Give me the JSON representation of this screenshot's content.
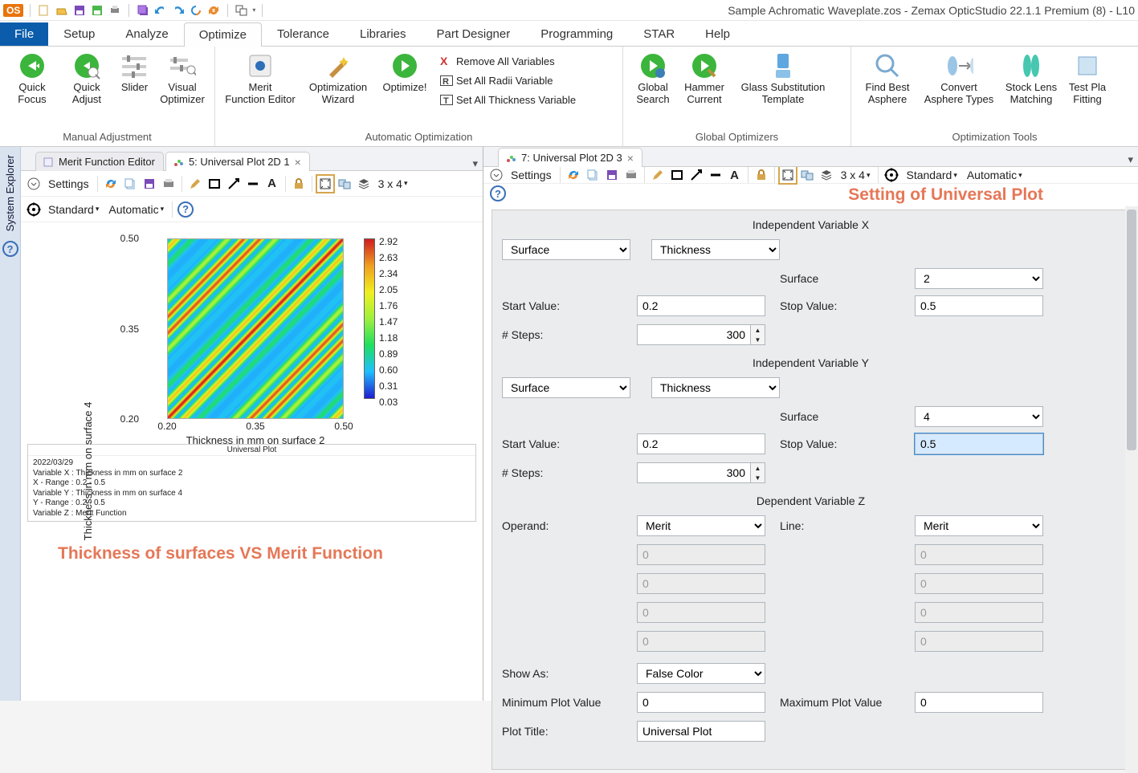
{
  "app_title": "Sample Achromatic Waveplate.zos - Zemax OpticStudio 22.1.1   Premium (8) - L10",
  "topbar": {
    "os": "OS"
  },
  "menu": {
    "file": "File",
    "tabs": [
      "Setup",
      "Analyze",
      "Optimize",
      "Tolerance",
      "Libraries",
      "Part Designer",
      "Programming",
      "STAR",
      "Help"
    ],
    "active": 2
  },
  "ribbon": {
    "manual_label": "Manual Adjustment",
    "auto_label": "Automatic Optimization",
    "global_label": "Global Optimizers",
    "tools_label": "Optimization Tools",
    "quick_focus": "Quick\nFocus",
    "quick_adjust": "Quick\nAdjust",
    "slider": "Slider",
    "visual_optimizer": "Visual\nOptimizer",
    "merit_editor": "Merit\nFunction Editor",
    "opt_wizard": "Optimization\nWizard",
    "optimize": "Optimize!",
    "remove_vars": "Remove All Variables",
    "set_radii": "Set All Radii Variable",
    "set_thick": "Set All Thickness Variable",
    "global_search": "Global\nSearch",
    "hammer": "Hammer\nCurrent",
    "glass_sub": "Glass Substitution\nTemplate",
    "best_asphere": "Find Best\nAsphere",
    "convert_asphere": "Convert\nAsphere Types",
    "stock_lens": "Stock Lens\nMatching",
    "test_plate": "Test Pla\nFitting"
  },
  "left_pane": {
    "tabs": [
      {
        "label": "Merit Function Editor",
        "closable": false
      },
      {
        "label": "5: Universal Plot 2D 1",
        "closable": true
      }
    ],
    "toolbar": {
      "settings": "Settings",
      "grid": "3 x 4",
      "standard": "Standard",
      "automatic": "Automatic"
    },
    "chart": {
      "title": "Universal Plot",
      "y_label": "Thickness in mm on surface 4",
      "x_label": "Thickness in mm on surface 2",
      "y_ticks": [
        "0.50",
        "0.35",
        "0.20"
      ],
      "x_ticks": [
        "0.20",
        "0.35",
        "0.50"
      ],
      "colorbar": [
        "2.92",
        "2.63",
        "2.34",
        "2.05",
        "1.76",
        "1.47",
        "1.18",
        "0.89",
        "0.60",
        "0.31",
        "0.03"
      ],
      "footer_date": "2022/03/29",
      "footer_l1": "Variable X : Thickness in mm on surface 2",
      "footer_l2": "X - Range   : 0.2 - 0.5",
      "footer_l3": "Variable Y : Thickness in mm on surface 4",
      "footer_l4": "Y - Range   : 0.2 - 0.5",
      "footer_l5": "Variable Z : Merit Function"
    },
    "annotation": "Thickness of surfaces VS Merit Function"
  },
  "right_pane": {
    "tab": {
      "label": "7: Universal Plot 2D 3",
      "closable": true
    },
    "toolbar": {
      "settings": "Settings",
      "grid": "3 x 4",
      "standard": "Standard",
      "automatic": "Automatic"
    },
    "annotation": "Setting of Universal Plot",
    "sections": {
      "ivx": "Independent Variable X",
      "ivy": "Independent Variable Y",
      "dvz": "Dependent Variable Z"
    },
    "labels": {
      "surface": "Surface",
      "start_value": "Start Value:",
      "stop_value": "Stop Value:",
      "num_steps": "# Steps:",
      "operand": "Operand:",
      "line": "Line:",
      "show_as": "Show As:",
      "min_plot": "Minimum Plot Value",
      "max_plot": "Maximum Plot Value",
      "plot_title": "Plot Title:"
    },
    "ivx": {
      "type": "Surface",
      "param": "Thickness",
      "surface": "2",
      "start": "0.2",
      "stop": "0.5",
      "steps": "300"
    },
    "ivy": {
      "type": "Surface",
      "param": "Thickness",
      "surface": "4",
      "start": "0.2",
      "stop": "0.5",
      "steps": "300"
    },
    "dvz": {
      "operand": "Merit",
      "line": "Merit",
      "op1": "0",
      "op2": "0",
      "op3": "0",
      "op4": "0",
      "ln1": "0",
      "ln2": "0",
      "ln3": "0",
      "ln4": "0"
    },
    "plot": {
      "show_as": "False Color",
      "min": "0",
      "max": "0",
      "title": "Universal Plot"
    }
  },
  "chart_data": {
    "type": "heatmap",
    "title": "Universal Plot",
    "xlabel": "Thickness in mm on surface 2",
    "ylabel": "Thickness in mm on surface 4",
    "xlim": [
      0.2,
      0.5
    ],
    "ylim": [
      0.2,
      0.5
    ],
    "zlim": [
      0.03,
      2.92
    ],
    "x_ticks": [
      0.2,
      0.35,
      0.5
    ],
    "y_ticks": [
      0.2,
      0.35,
      0.5
    ],
    "colorbar_ticks": [
      2.92,
      2.63,
      2.34,
      2.05,
      1.76,
      1.47,
      1.18,
      0.89,
      0.6,
      0.31,
      0.03
    ],
    "description": "Diagonal periodic ridges: z-value depends roughly on (x−y); ridges repeat ~10 times across the x range. Minima along y≈x line; maxima on alternating offset diagonals.",
    "colormap": [
      "#2020d0",
      "#20c0ff",
      "#20e060",
      "#a0f040",
      "#f0f020",
      "#f0a020",
      "#d02020"
    ]
  }
}
